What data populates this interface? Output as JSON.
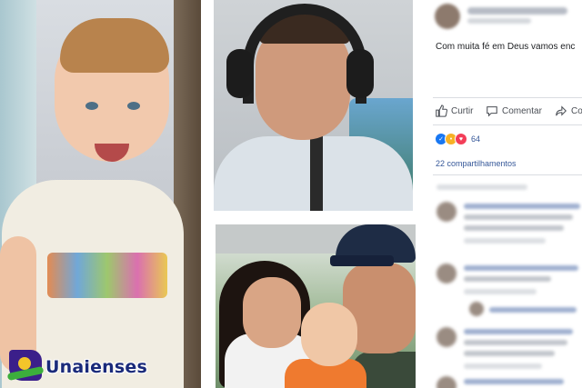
{
  "watermark": {
    "label": "Unaienses"
  },
  "post": {
    "text": "Com muita fé em Deus vamos enc",
    "actions": {
      "like_label": "Curtir",
      "comment_label": "Comentar",
      "share_label": "Co"
    },
    "reactions": {
      "icons": [
        "like-icon",
        "sad-icon",
        "love-icon"
      ],
      "count": "64"
    },
    "shares_label": "22 compartilhamentos"
  },
  "colors": {
    "facebook_blue": "#365899",
    "like_blue": "#1877f2",
    "love_red": "#f33e58",
    "sad_yellow": "#f7b125",
    "text_dark": "#1c1e21",
    "action_grey": "#4b4f56"
  }
}
